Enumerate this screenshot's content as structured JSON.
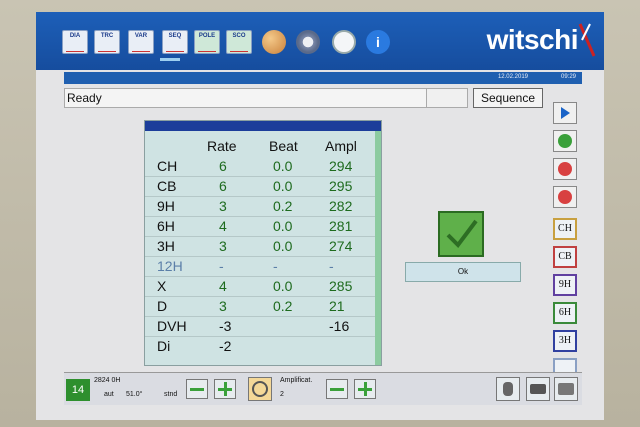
{
  "toolbar": {
    "icons": [
      {
        "label": "DIA",
        "name": "dia-icon"
      },
      {
        "label": "TRC",
        "name": "trc-icon"
      },
      {
        "label": "VAR",
        "name": "var-icon"
      },
      {
        "label": "SEQ",
        "name": "seq-icon"
      },
      {
        "label": "POLE",
        "name": "pole-icon"
      },
      {
        "label": "SCO",
        "name": "sco-icon"
      }
    ],
    "brand": "witschi"
  },
  "status": {
    "date": "12.02.2019",
    "time": "09:29"
  },
  "ready_text": "Ready",
  "sequence_button": "Sequence",
  "table": {
    "headers": [
      "Rate",
      "Beat",
      "Ampl"
    ],
    "rows": [
      {
        "label": "CH",
        "rate": "6",
        "beat": "0.0",
        "ampl": "294"
      },
      {
        "label": "CB",
        "rate": "6",
        "beat": "0.0",
        "ampl": "295"
      },
      {
        "label": "9H",
        "rate": "3",
        "beat": "0.2",
        "ampl": "282"
      },
      {
        "label": "6H",
        "rate": "4",
        "beat": "0.0",
        "ampl": "281"
      },
      {
        "label": "3H",
        "rate": "3",
        "beat": "0.0",
        "ampl": "274"
      },
      {
        "label": "12H",
        "rate": "-",
        "beat": "-",
        "ampl": "-"
      },
      {
        "label": "X",
        "rate": "4",
        "beat": "0.0",
        "ampl": "285"
      },
      {
        "label": "D",
        "rate": "3",
        "beat": "0.2",
        "ampl": "21"
      },
      {
        "label": "DVH",
        "rate": "-3",
        "beat": "",
        "ampl": "-16"
      },
      {
        "label": "Di",
        "rate": "-2",
        "beat": "",
        "ampl": ""
      }
    ]
  },
  "ok_button": "Ok",
  "right_tags": [
    "CH",
    "CB",
    "9H",
    "6H",
    "3H"
  ],
  "bottom": {
    "badge": "14",
    "line1": "2824 0H",
    "aut": "aut",
    "angle": "51.0°",
    "stnd": "stnd",
    "ampl_label": "Amplificat.",
    "ampl_value": "2"
  },
  "colors": {
    "accent": "#1b5cb5",
    "ok_green": "#5fb04a",
    "rate_green": "#1e6b1e"
  }
}
